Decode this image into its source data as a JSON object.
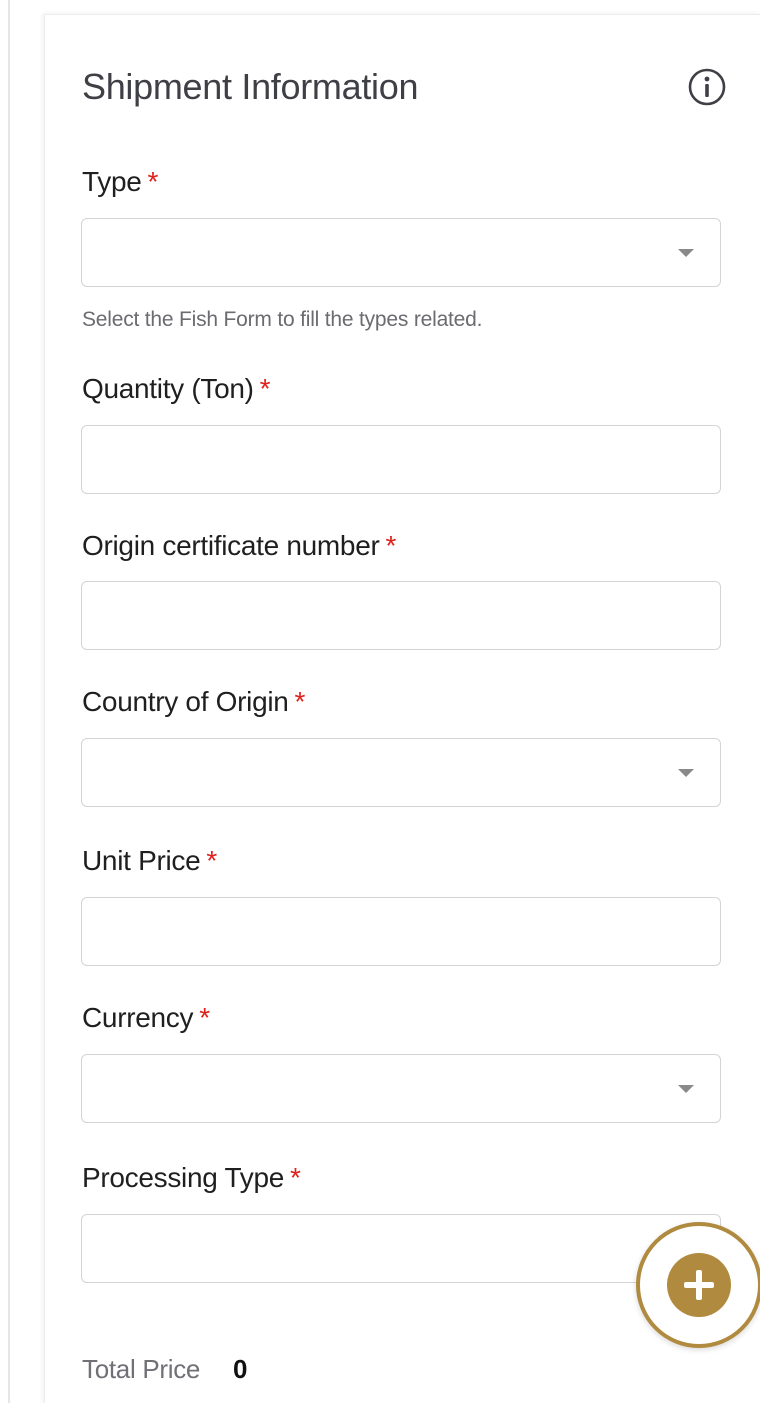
{
  "form": {
    "title": "Shipment Information",
    "required_mark": "*",
    "fields": {
      "type": {
        "label": "Type",
        "value": ""
      },
      "type_hint": "Select the Fish Form to fill the types related.",
      "quantity": {
        "label": "Quantity (Ton)",
        "value": ""
      },
      "origin_certificate": {
        "label": "Origin certificate number",
        "value": ""
      },
      "country_of_origin": {
        "label": "Country of Origin",
        "value": ""
      },
      "unit_price": {
        "label": "Unit Price",
        "value": ""
      },
      "currency": {
        "label": "Currency",
        "value": ""
      },
      "processing_type": {
        "label": "Processing Type",
        "value": ""
      }
    },
    "total": {
      "label": "Total Price",
      "value": "0"
    }
  },
  "icons": {
    "info": "info-icon",
    "dropdown": "chevron-down-icon",
    "add": "plus-icon"
  },
  "colors": {
    "accent": "#b08a3e",
    "required": "#e0201b"
  }
}
